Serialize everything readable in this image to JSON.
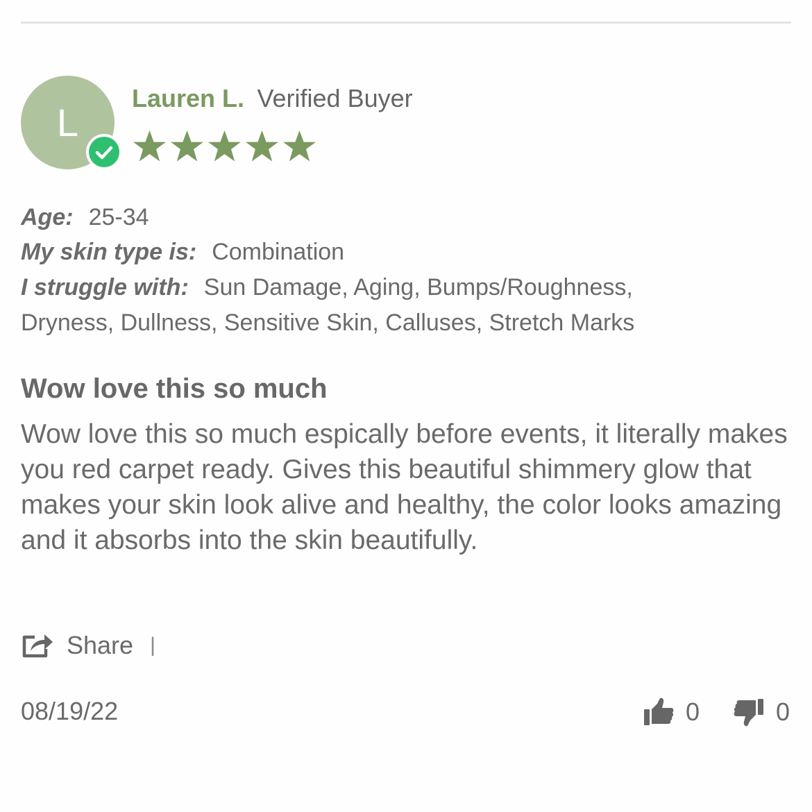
{
  "review": {
    "avatar_initial": "L",
    "author_name": "Lauren L.",
    "buyer_badge": "Verified Buyer",
    "rating": 5,
    "rating_max": 5,
    "attributes": [
      {
        "label": "Age:",
        "value": "25-34"
      },
      {
        "label": "My skin type is:",
        "value": "Combination"
      },
      {
        "label": "I struggle with:",
        "value": "Sun Damage, Aging, Bumps/Roughness,",
        "continuation": "Dryness, Dullness, Sensitive Skin, Calluses, Stretch Marks"
      }
    ],
    "title": "Wow love this so much",
    "body": "Wow love this so much espically before events, it literally makes you red carpet ready. Gives this beautiful shimmery glow that makes your skin look alive and healthy, the color looks amazing and it absorbs into the skin beautifully.",
    "share_label": "Share",
    "share_separator": "|",
    "date": "08/19/22",
    "votes_up": "0",
    "votes_down": "0"
  },
  "colors": {
    "accent_green": "#7a9a60",
    "avatar_bg": "#b0c39f",
    "verified_badge": "#2fbf71",
    "text_gray": "#6a6a6a"
  },
  "icons": {
    "verified": "check-circle-icon",
    "star": "star-icon",
    "share": "share-icon",
    "vote_up": "thumbs-up-icon",
    "vote_down": "thumbs-down-icon"
  }
}
